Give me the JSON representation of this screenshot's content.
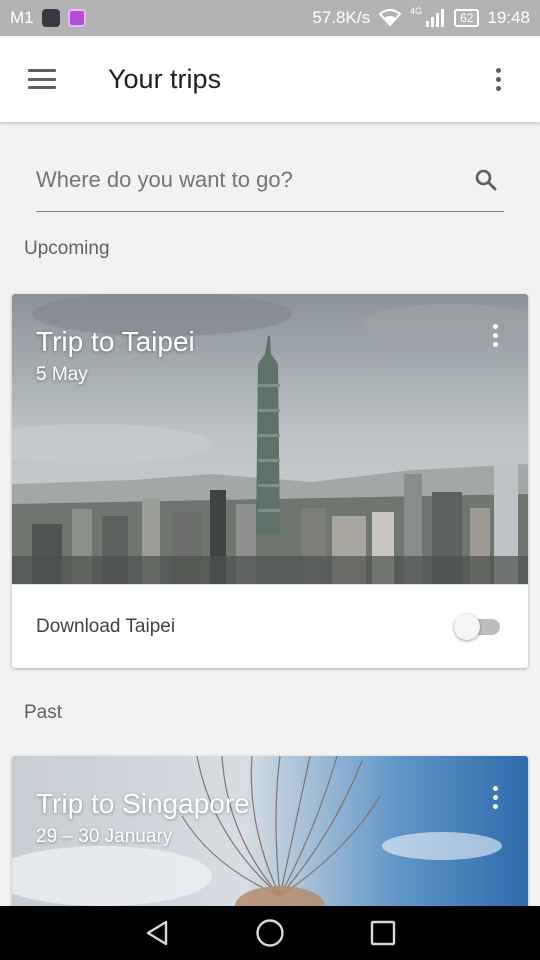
{
  "status_bar": {
    "carrier": "M1",
    "speed": "57.8K/s",
    "network": "4G",
    "battery": "62",
    "time": "19:48"
  },
  "app_bar": {
    "title": "Your trips",
    "menu_icon": "hamburger-menu-icon",
    "overflow_icon": "more-vert-icon"
  },
  "search": {
    "placeholder": "Where do you want to go?",
    "value": "",
    "icon": "search-icon"
  },
  "sections": {
    "upcoming": "Upcoming",
    "past": "Past"
  },
  "trips": {
    "upcoming": {
      "title": "Trip to Taipei",
      "date": "5 May",
      "download_label": "Download Taipei",
      "download_enabled": false
    },
    "past": {
      "title": "Trip to Singapore",
      "date": "29 – 30 January"
    }
  },
  "nav_bar": {
    "back_icon": "back-triangle-icon",
    "home_icon": "home-circle-icon",
    "recents_icon": "recents-square-icon"
  },
  "colors": {
    "status_bar": "#b3b3b3",
    "app_bar": "#ffffff",
    "background": "#f2f2f2",
    "nav_bar": "#000000"
  }
}
